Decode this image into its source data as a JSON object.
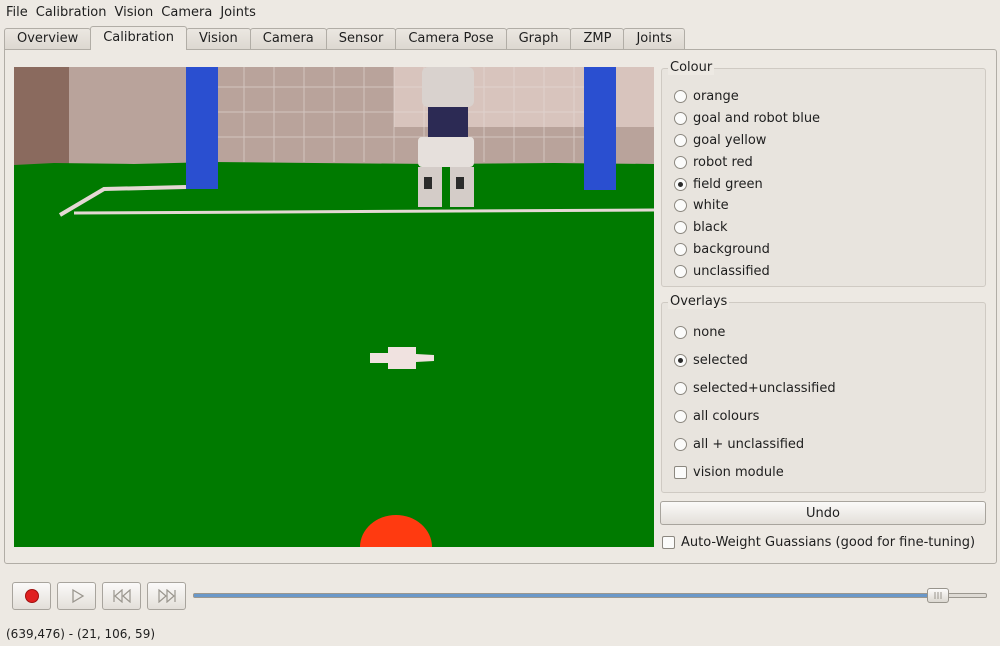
{
  "menu": [
    "File",
    "Calibration",
    "Vision",
    "Camera",
    "Joints"
  ],
  "menu_mnemonics": [
    "F",
    "C",
    "V",
    "C",
    "J"
  ],
  "tabs": [
    "Overview",
    "Calibration",
    "Vision",
    "Camera",
    "Sensor",
    "Camera Pose",
    "Graph",
    "ZMP",
    "Joints"
  ],
  "active_tab": "Calibration",
  "colour": {
    "title": "Colour",
    "options": [
      "orange",
      "goal and robot blue",
      "goal yellow",
      "robot red",
      "field green",
      "white",
      "black",
      "background",
      "unclassified"
    ],
    "selected": "field green"
  },
  "overlays": {
    "title": "Overlays",
    "options": [
      "none",
      "selected",
      "selected+unclassified",
      "all colours",
      "all + unclassified"
    ],
    "selected": "selected",
    "checkbox_label": "vision module",
    "checkbox_checked": false
  },
  "undo_label": "Undo",
  "auto_weight_label": "Auto-Weight Guassians (good for fine-tuning)",
  "auto_weight_checked": false,
  "playback": {
    "record_icon": "record-icon",
    "play_icon": "play-icon",
    "rewind_icon": "rewind-icon",
    "fast_forward_icon": "fast-forward-icon",
    "slider_fraction": 0.94
  },
  "status_text": "(639,476) - (21, 106, 59)",
  "colors": {
    "field_green": "#007a00",
    "record_red": "#e02020",
    "slider_fill": "#6a98c9",
    "goal_blue": "#2a4fd0",
    "ball_orange": "#ff3a10"
  }
}
